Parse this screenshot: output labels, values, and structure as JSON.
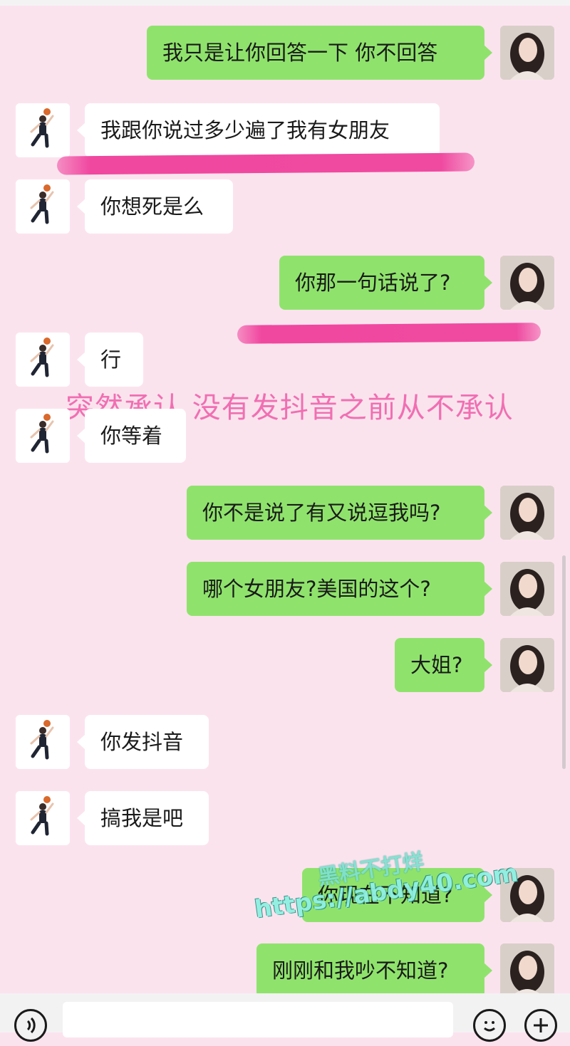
{
  "messages": [
    {
      "side": "me",
      "text": "我只是让你回答一下 你不回答"
    },
    {
      "side": "other",
      "text": "我跟你说过多少遍了我有女朋友"
    },
    {
      "side": "other",
      "text": "你想死是么"
    },
    {
      "side": "me",
      "text": "你那一句话说了?"
    },
    {
      "side": "other",
      "text": "行"
    },
    {
      "side": "other",
      "text": "你等着"
    },
    {
      "side": "me",
      "text": "你不是说了有又说逗我吗?"
    },
    {
      "side": "me",
      "text": "哪个女朋友?美国的这个?"
    },
    {
      "side": "me",
      "text": "大姐?"
    },
    {
      "side": "other",
      "text": "你发抖音"
    },
    {
      "side": "other",
      "text": "搞我是吧"
    },
    {
      "side": "me",
      "text": "你现在不知道?"
    },
    {
      "side": "me",
      "text": "刚刚和我吵不知道?"
    }
  ],
  "annotation": "突然承认 没有发抖音之前从不承认",
  "watermark": {
    "label": "黑料不打烊",
    "url": "https://abdy40.com"
  },
  "icons": {
    "voice": "voice-icon",
    "mic": "mic-icon",
    "emoji": "emoji-icon",
    "plus": "plus-icon"
  },
  "colors": {
    "background": "#fbe3ee",
    "my_bubble": "#8fe36c",
    "other_bubble": "#ffffff",
    "highlight": "#f0479f",
    "annotation": "#f06fb2"
  }
}
